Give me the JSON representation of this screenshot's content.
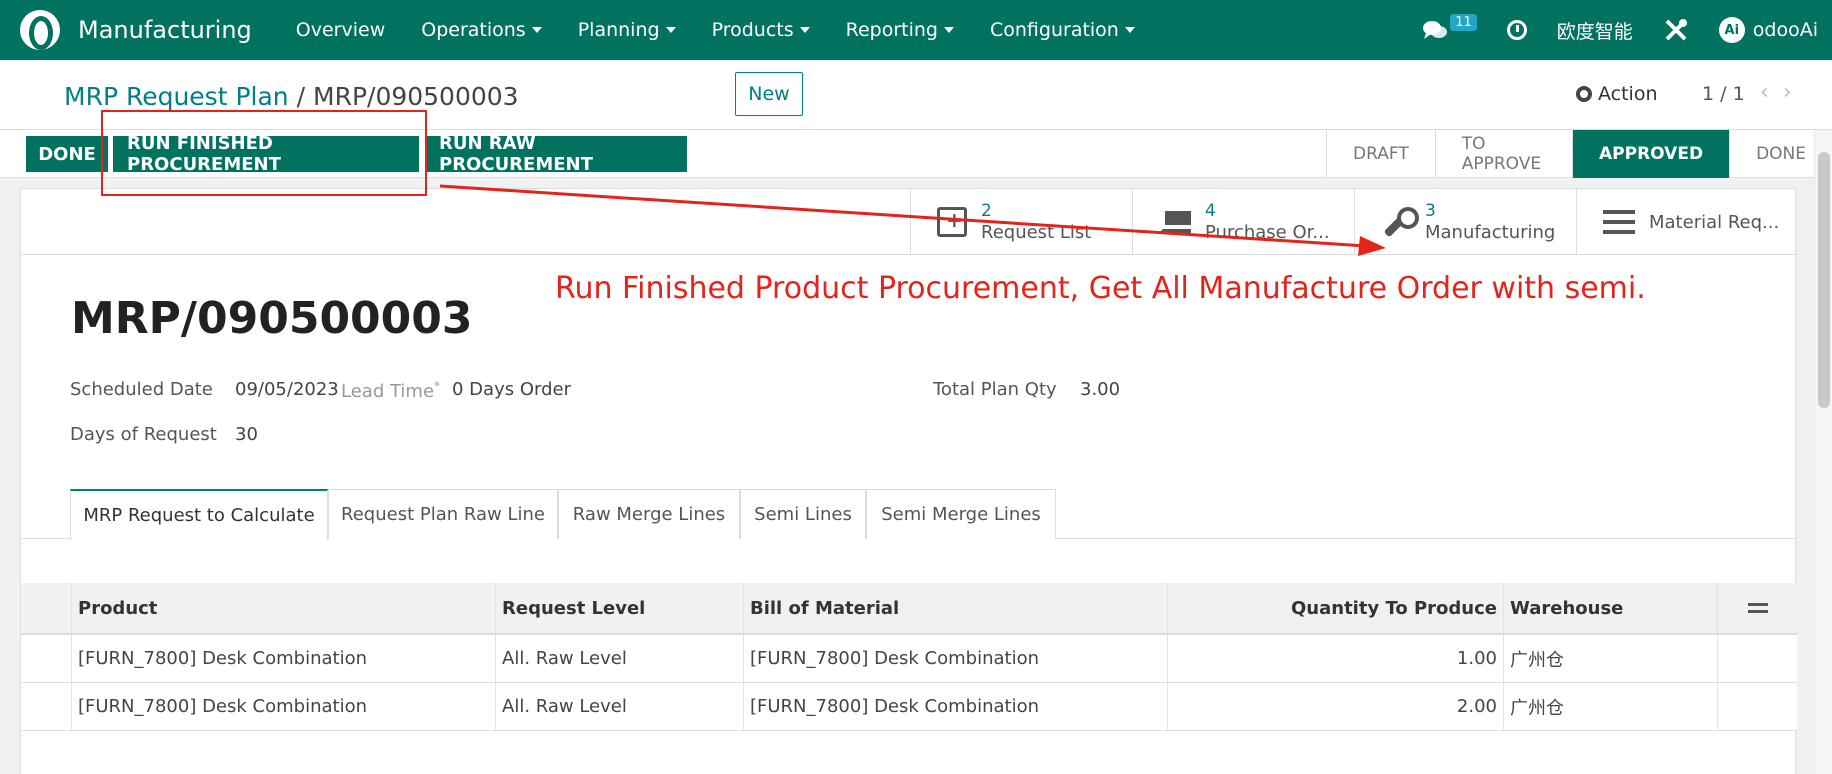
{
  "navbar": {
    "app_name": "Manufacturing",
    "menus": [
      "Overview",
      "Operations",
      "Planning",
      "Products",
      "Reporting",
      "Configuration"
    ],
    "chat_count": "11",
    "company": "欧度智能",
    "user_initials": "Ai",
    "user_name": "odooAi"
  },
  "breadcrumb": {
    "parent": "MRP Request Plan",
    "separator": "/",
    "current": "MRP/090500003"
  },
  "control": {
    "new_label": "New",
    "action_label": "Action",
    "pager": "1 / 1",
    "prev": "‹",
    "next": "›"
  },
  "status_buttons": [
    "DONE",
    "RUN FINISHED PROCUREMENT",
    "RUN RAW PROCUREMENT"
  ],
  "stages": [
    "DRAFT",
    "TO APPROVE",
    "APPROVED",
    "DONE"
  ],
  "smart_buttons": [
    {
      "count": "2",
      "label": "Request List"
    },
    {
      "count": "4",
      "label": "Purchase Or..."
    },
    {
      "count": "3",
      "label": "Manufacturing"
    },
    {
      "count": "",
      "label": "Material Req..."
    }
  ],
  "annotation": "Run Finished Product Procurement, Get All Manufacture Order with semi.",
  "record": {
    "title": "MRP/090500003",
    "scheduled_date_label": "Scheduled Date",
    "scheduled_date": "09/05/2023",
    "lead_time_label": "Lead Time",
    "lead_time_marker": "*",
    "lead_time_value": "0 Days Order",
    "total_plan_qty_label": "Total Plan Qty",
    "total_plan_qty": "3.00",
    "days_of_request_label": "Days of Request",
    "days_of_request": "30"
  },
  "tabs": [
    "MRP Request to Calculate",
    "Request Plan Raw Line",
    "Raw Merge Lines",
    "Semi Lines",
    "Semi Merge Lines"
  ],
  "table": {
    "headers": [
      "Product",
      "Request Level",
      "Bill of Material",
      "Quantity To Produce",
      "Warehouse"
    ],
    "rows": [
      [
        "[FURN_7800] Desk Combination",
        "All. Raw Level",
        "[FURN_7800] Desk Combination",
        "1.00",
        "广州仓"
      ],
      [
        "[FURN_7800] Desk Combination",
        "All. Raw Level",
        "[FURN_7800] Desk Combination",
        "2.00",
        "广州仓"
      ]
    ]
  },
  "colors": {
    "brand": "#00725f",
    "link": "#017e84",
    "annotation": "#e3241b"
  }
}
